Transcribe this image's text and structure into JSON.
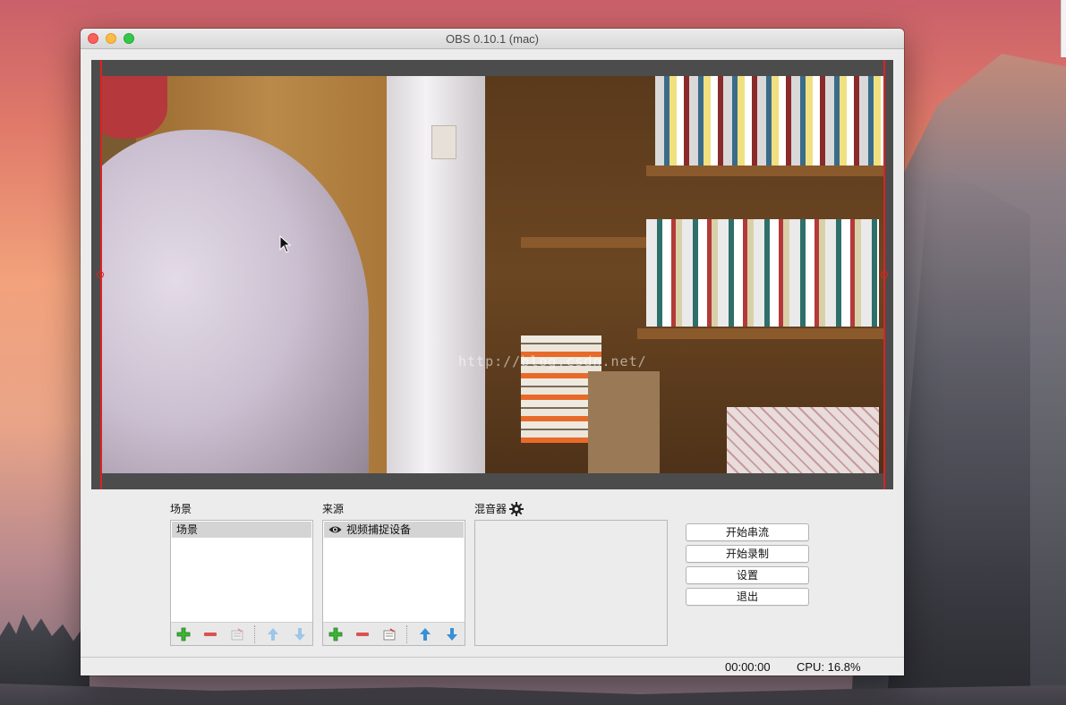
{
  "window": {
    "title": "OBS 0.10.1 (mac)"
  },
  "preview": {
    "watermark": "http://blog.csdn.net/"
  },
  "scenes": {
    "label": "场景",
    "items": [
      "场景"
    ]
  },
  "sources": {
    "label": "来源",
    "items": [
      "视频捕捉设备"
    ]
  },
  "mixer": {
    "label": "混音器"
  },
  "controls": {
    "start_streaming": "开始串流",
    "start_recording": "开始录制",
    "settings": "设置",
    "exit": "退出"
  },
  "status": {
    "time": "00:00:00",
    "cpu": "CPU: 16.8%"
  },
  "colors": {
    "add": "#3cb534",
    "remove": "#d9534f",
    "arrow_active": "#3a8fd6",
    "arrow_inactive": "#9cc6ea",
    "selection_edge": "#dd2222"
  },
  "icons": [
    "add-icon",
    "remove-icon",
    "properties-icon",
    "move-up-icon",
    "move-down-icon",
    "eye-icon",
    "gear-icon"
  ]
}
